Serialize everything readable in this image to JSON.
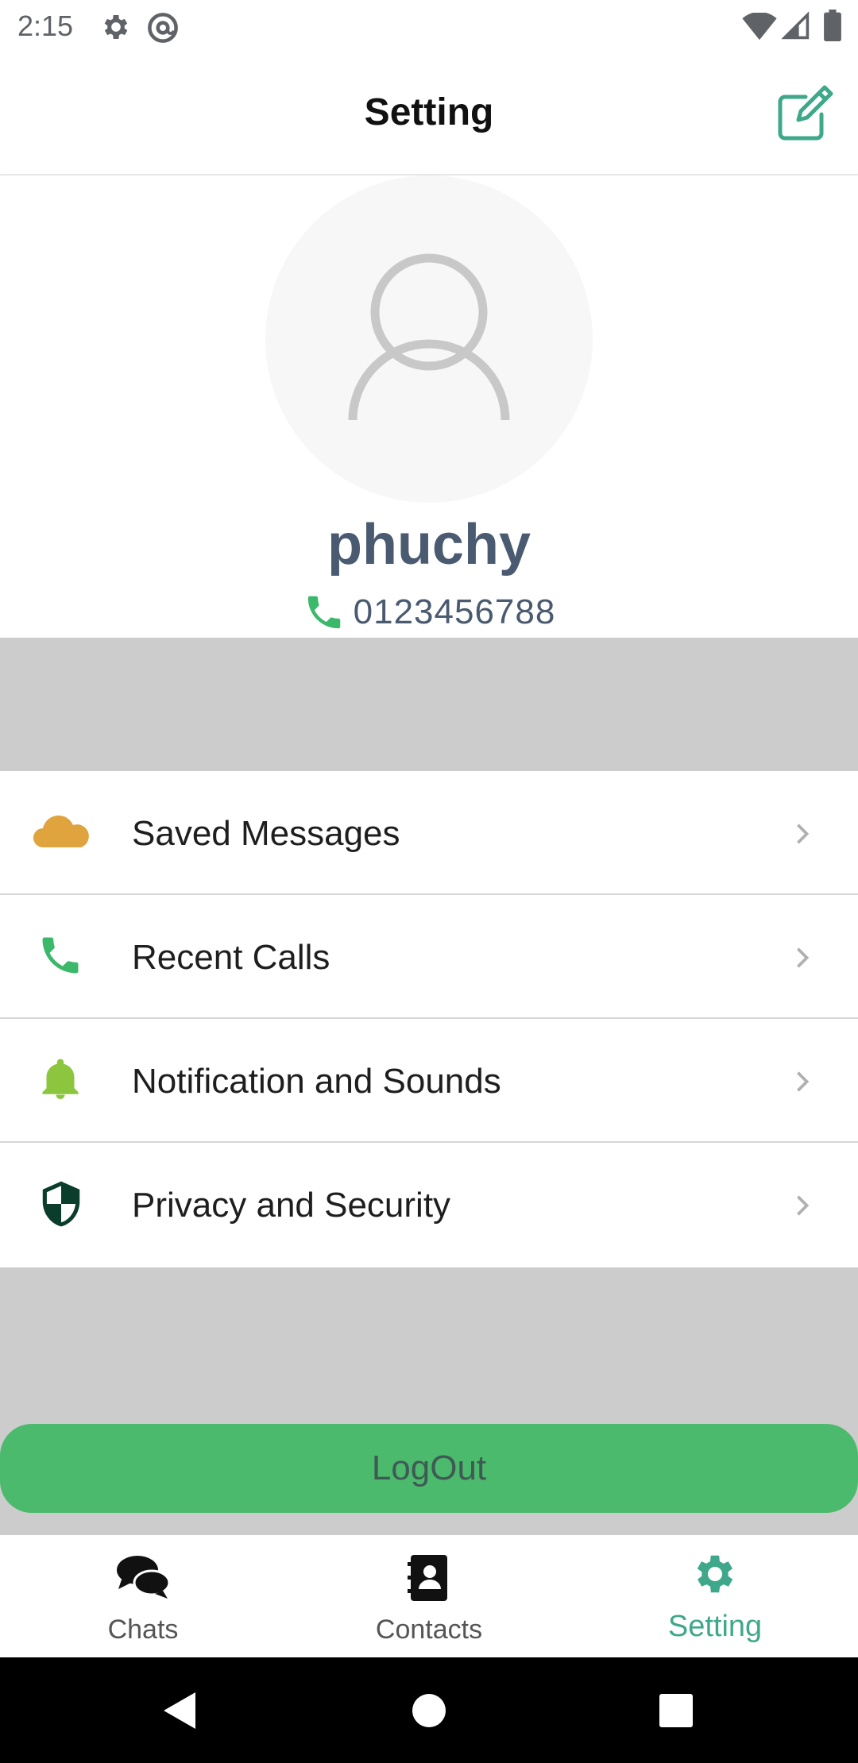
{
  "status_bar": {
    "time": "2:15",
    "left_icons": [
      "settings-icon",
      "at-sign-icon"
    ],
    "right_icons": [
      "wifi-icon",
      "signal-icon",
      "battery-icon"
    ]
  },
  "header": {
    "title": "Setting",
    "action_icon": "edit-icon",
    "accent_color": "#3fa88a"
  },
  "profile": {
    "avatar_icon": "user-placeholder-icon",
    "name": "phuchy",
    "phone_icon": "phone-icon",
    "phone": "0123456788"
  },
  "menu": {
    "items": [
      {
        "label": "Saved Messages",
        "icon": "cloud-icon",
        "icon_color": "#e0a43e"
      },
      {
        "label": "Recent Calls",
        "icon": "phone-icon",
        "icon_color": "#3bb86a"
      },
      {
        "label": "Notification and Sounds",
        "icon": "bell-icon",
        "icon_color": "#8cc63f"
      },
      {
        "label": "Privacy and Security",
        "icon": "shield-icon",
        "icon_color": "#0b3d2c"
      }
    ]
  },
  "logout": {
    "label": "LogOut",
    "color": "#4cba6c"
  },
  "bottom_nav": {
    "items": [
      {
        "label": "Chats",
        "icon": "chat-bubbles-icon",
        "active": false
      },
      {
        "label": "Contacts",
        "icon": "contact-book-icon",
        "active": false
      },
      {
        "label": "Setting",
        "icon": "gear-icon",
        "active": true
      }
    ]
  },
  "system_nav": [
    "back-icon",
    "home-icon",
    "recents-icon"
  ]
}
